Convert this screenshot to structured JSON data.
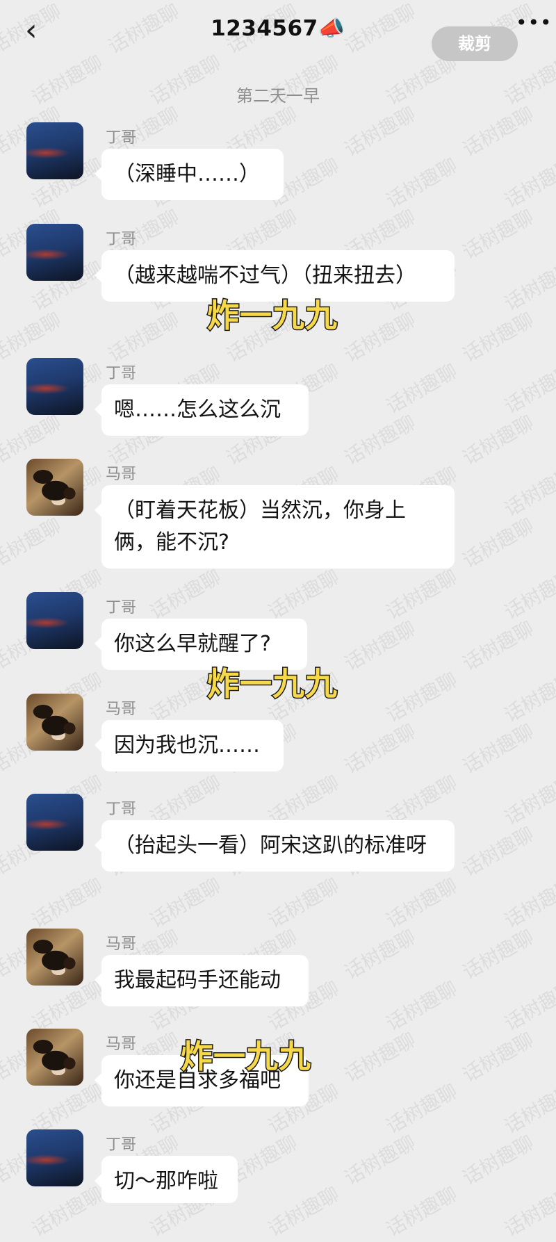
{
  "header": {
    "back_icon": "chevron-left-icon",
    "title": "1234567📣",
    "crop_label": "裁剪",
    "more_label": "•••"
  },
  "timestamp": "第二天一早",
  "messages": [
    {
      "sender": "丁哥",
      "avatar": "blue",
      "text": "（深睡中……）"
    },
    {
      "sender": "丁哥",
      "avatar": "blue",
      "text": "（越来越喘不过气）（扭来扭去）"
    },
    {
      "sender": "丁哥",
      "avatar": "blue",
      "text": "嗯……怎么这么沉"
    },
    {
      "sender": "马哥",
      "avatar": "dog",
      "text": "（盯着天花板）当然沉，你身上俩，能不沉?"
    },
    {
      "sender": "丁哥",
      "avatar": "blue",
      "text": "你这么早就醒了?"
    },
    {
      "sender": "马哥",
      "avatar": "dog",
      "text": "因为我也沉……"
    },
    {
      "sender": "丁哥",
      "avatar": "blue",
      "text": "（抬起头一看）阿宋这趴的标准呀"
    },
    {
      "sender": "马哥",
      "avatar": "dog",
      "text": "我最起码手还能动"
    },
    {
      "sender": "马哥",
      "avatar": "dog",
      "text": "你还是自求多福吧"
    },
    {
      "sender": "丁哥",
      "avatar": "blue",
      "text": "切～那咋啦"
    }
  ],
  "overlays": [
    "炸一九九",
    "炸一九九",
    "炸一九九"
  ],
  "watermark": "话树趣聊"
}
